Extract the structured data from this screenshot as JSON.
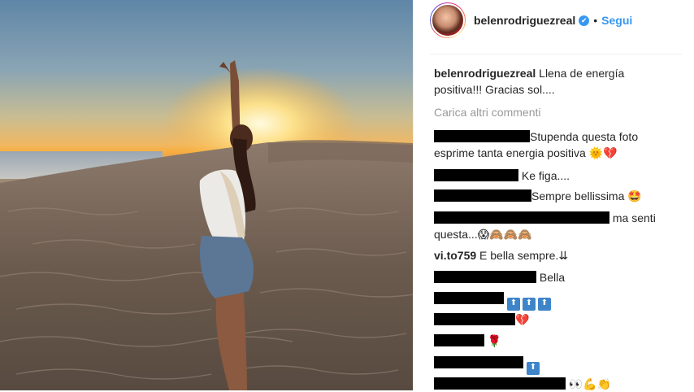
{
  "post": {
    "username": "belenrodriguezreal",
    "verified_badge": "✔",
    "separator": "•",
    "follow_label": "Segui",
    "caption_text": "Llena de energía positiva!!! Gracias sol....",
    "load_more_comments": "Carica altri commenti"
  },
  "comments": [
    {
      "text": "Stupenda questa foto esprime tanta energia positiva",
      "emoji": "🌞💔"
    },
    {
      "text": "Ke figa....",
      "emoji": ""
    },
    {
      "text": "Sempre bellissima",
      "emoji": "🤩"
    },
    {
      "text": "ma senti questa...",
      "emoji": "😱🙈🙈🙈"
    },
    {
      "username": "vi.to759",
      "text": "E bella sempre.",
      "emoji": "⇊"
    },
    {
      "text": "Bella",
      "emoji": ""
    },
    {
      "text": "",
      "emoji": "TOP TOP TOP"
    },
    {
      "text": "",
      "emoji": "💔"
    },
    {
      "text": "",
      "emoji": "🌹"
    },
    {
      "text": "",
      "emoji": "TOP"
    },
    {
      "text": "",
      "emoji": "👀💪👏"
    }
  ],
  "colors": {
    "link_blue": "#3897f0",
    "text": "#262626",
    "muted": "#999999"
  },
  "icons": [
    "verified-badge-icon",
    "top-emoji-icon"
  ]
}
